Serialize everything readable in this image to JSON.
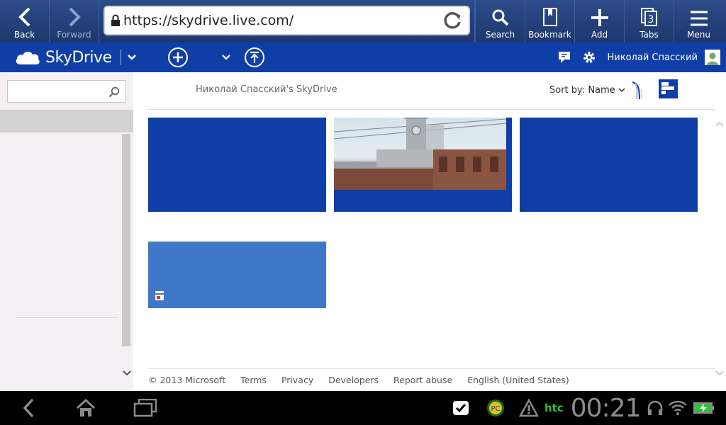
{
  "browser": {
    "back_label": "Back",
    "forward_label": "Forward",
    "url": "https://skydrive.live.com/",
    "search_label": "Search",
    "bookmark_label": "Bookmark",
    "add_label": "Add",
    "tabs_label": "Tabs",
    "tabs_count": "3",
    "menu_label": "Menu"
  },
  "header": {
    "brand": "SkyDrive",
    "user_name": "Николай Спасский",
    "brand_color": "#0f3fa6"
  },
  "sidebar": {
    "search_placeholder": ""
  },
  "main": {
    "breadcrumb": "Николай Спасский's SkyDrive",
    "sort_label": "Sort by:",
    "sort_value": "Name",
    "tiles": [
      {
        "type": "folder",
        "color": "#0f3fa6"
      },
      {
        "type": "photo-album",
        "color": "#0f3fa6"
      },
      {
        "type": "folder",
        "color": "#0f3fa6"
      },
      {
        "type": "document",
        "color": "#3f78c6"
      }
    ]
  },
  "footer": {
    "copyright": "© 2013 Microsoft",
    "links": [
      "Terms",
      "Privacy",
      "Developers",
      "Report abuse",
      "English (United States)"
    ]
  },
  "system": {
    "clock": "00:21",
    "brand": "htc"
  }
}
